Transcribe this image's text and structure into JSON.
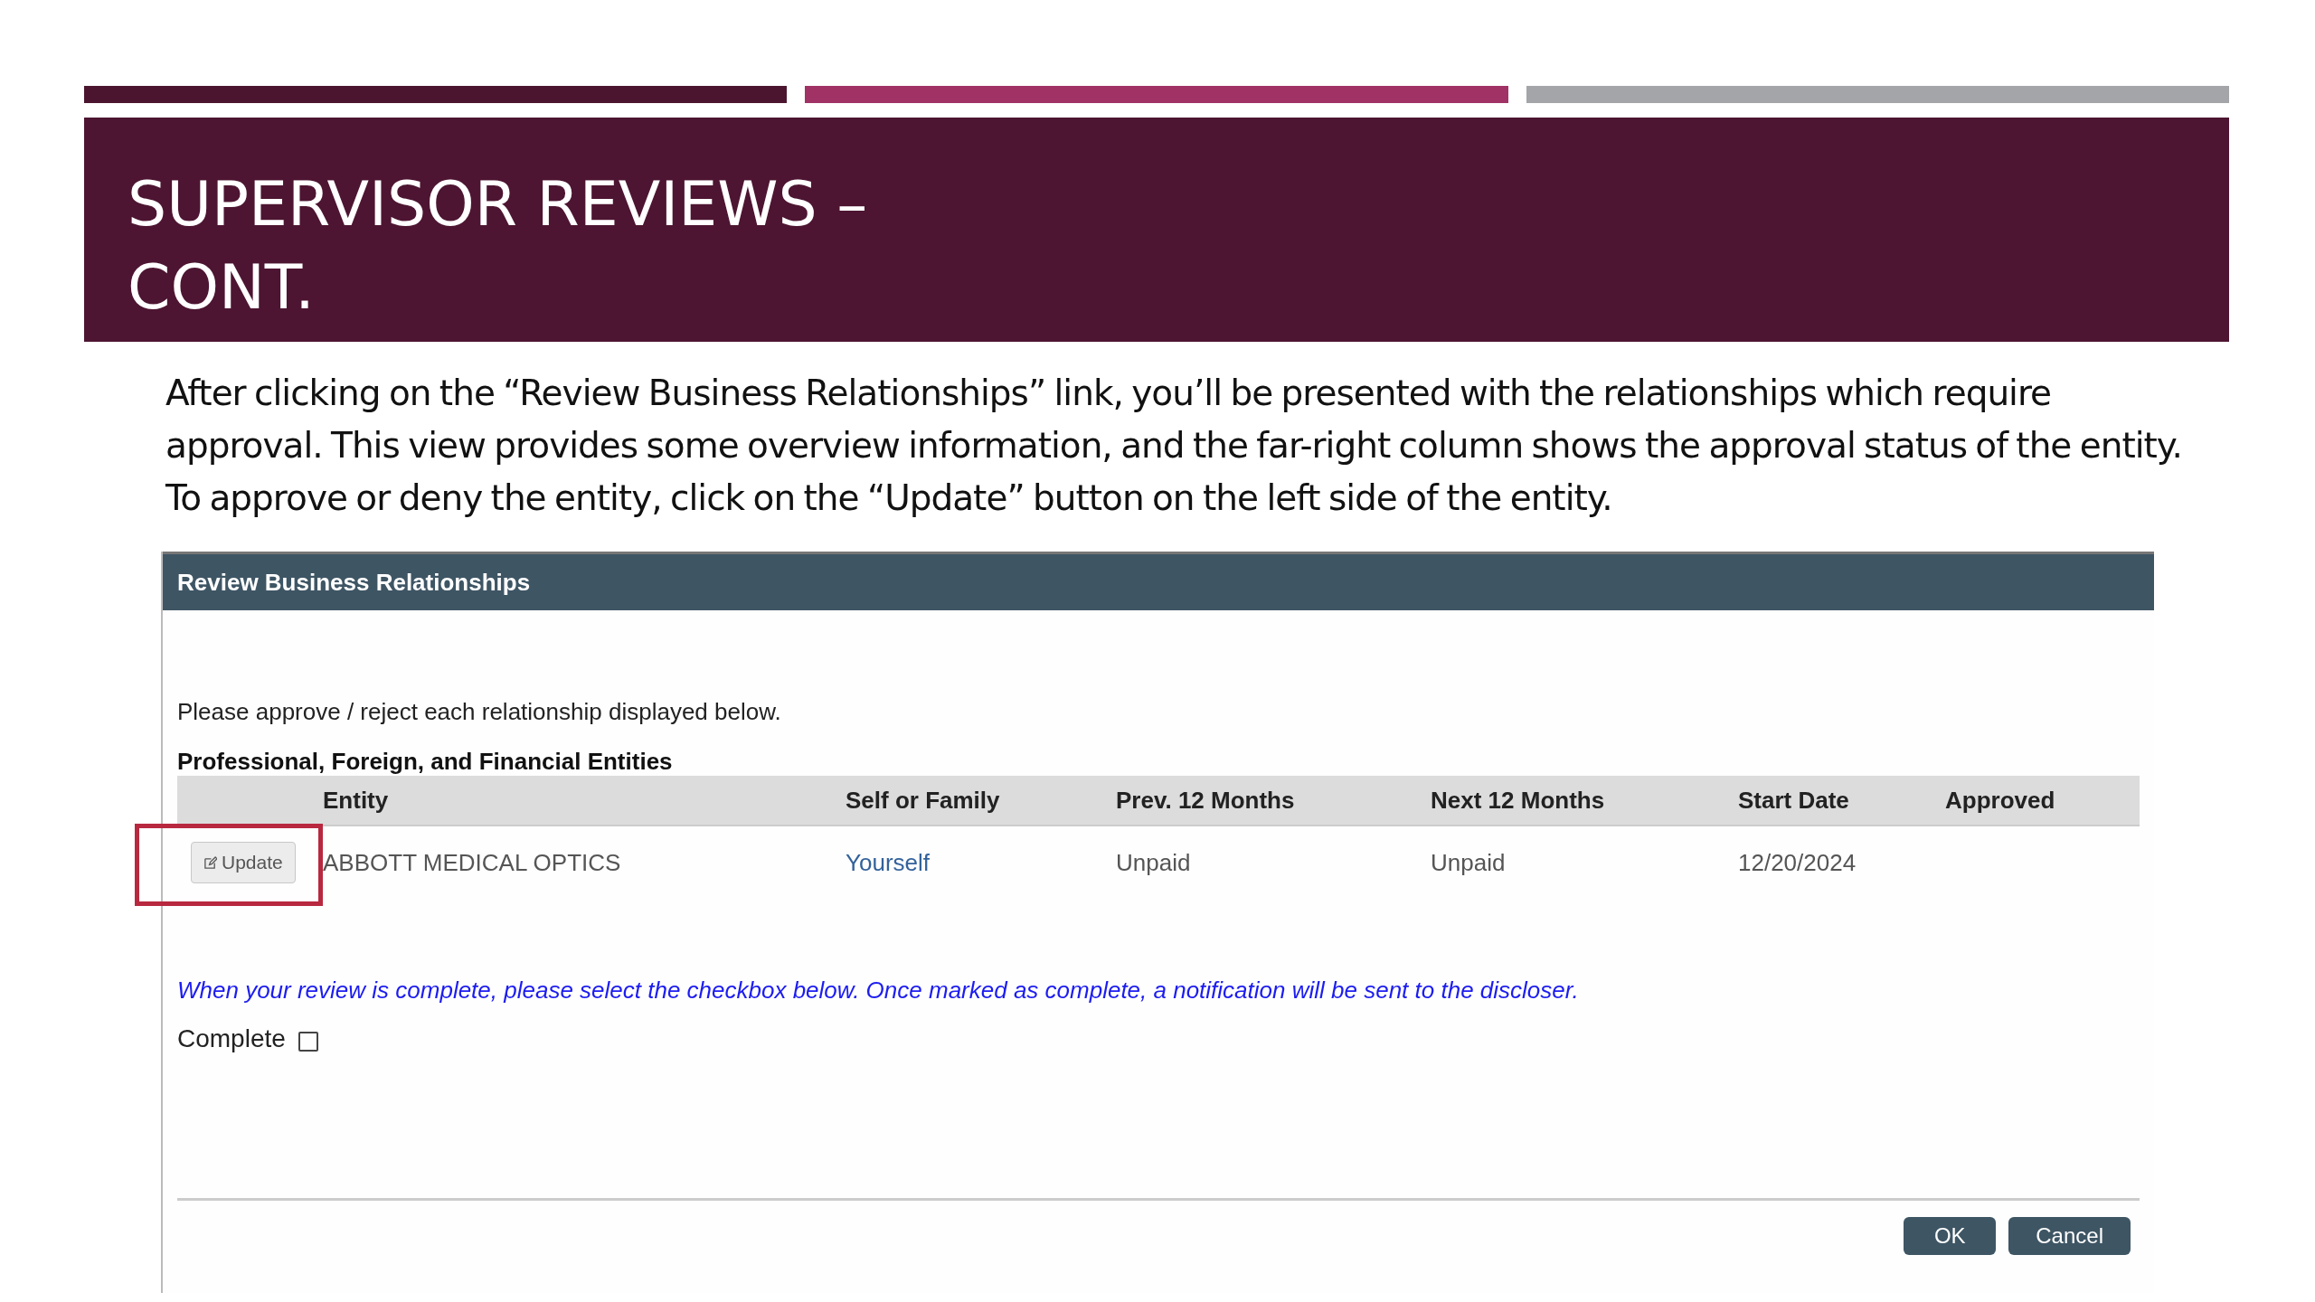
{
  "slide": {
    "title_lines": [
      "SUPERVISOR REVIEWS –",
      "CONT."
    ],
    "body": "After clicking on the “Review Business Relationships” link, you’ll be presented with the relationships which require approval. This view provides some overview information, and the far-right column shows the approval status of the entity. To approve or deny the entity, click on the “Update” button on the left side of the entity."
  },
  "panel": {
    "title": "Review Business Relationships",
    "instruction": "Please approve / reject each relationship displayed below.",
    "section_heading": "Professional, Foreign, and Financial Entities",
    "table": {
      "columns": [
        "Entity",
        "Self or Family",
        "Prev. 12 Months",
        "Next 12 Months",
        "Start Date",
        "Approved"
      ],
      "rows": [
        {
          "button": "Update",
          "highlighted": true,
          "entity": "ABBOTT MEDICAL OPTICS",
          "self_or_family": "Yourself",
          "prev_12_months": "Unpaid",
          "next_12_months": "Unpaid",
          "start_date": "12/20/2024"
        }
      ]
    },
    "note": "When your review is complete, please select the checkbox below. Once marked as complete, a notification will be sent to the discloser.",
    "complete": {
      "label": "Complete",
      "checked": false
    },
    "buttons": [
      "OK",
      "Cancel"
    ]
  }
}
